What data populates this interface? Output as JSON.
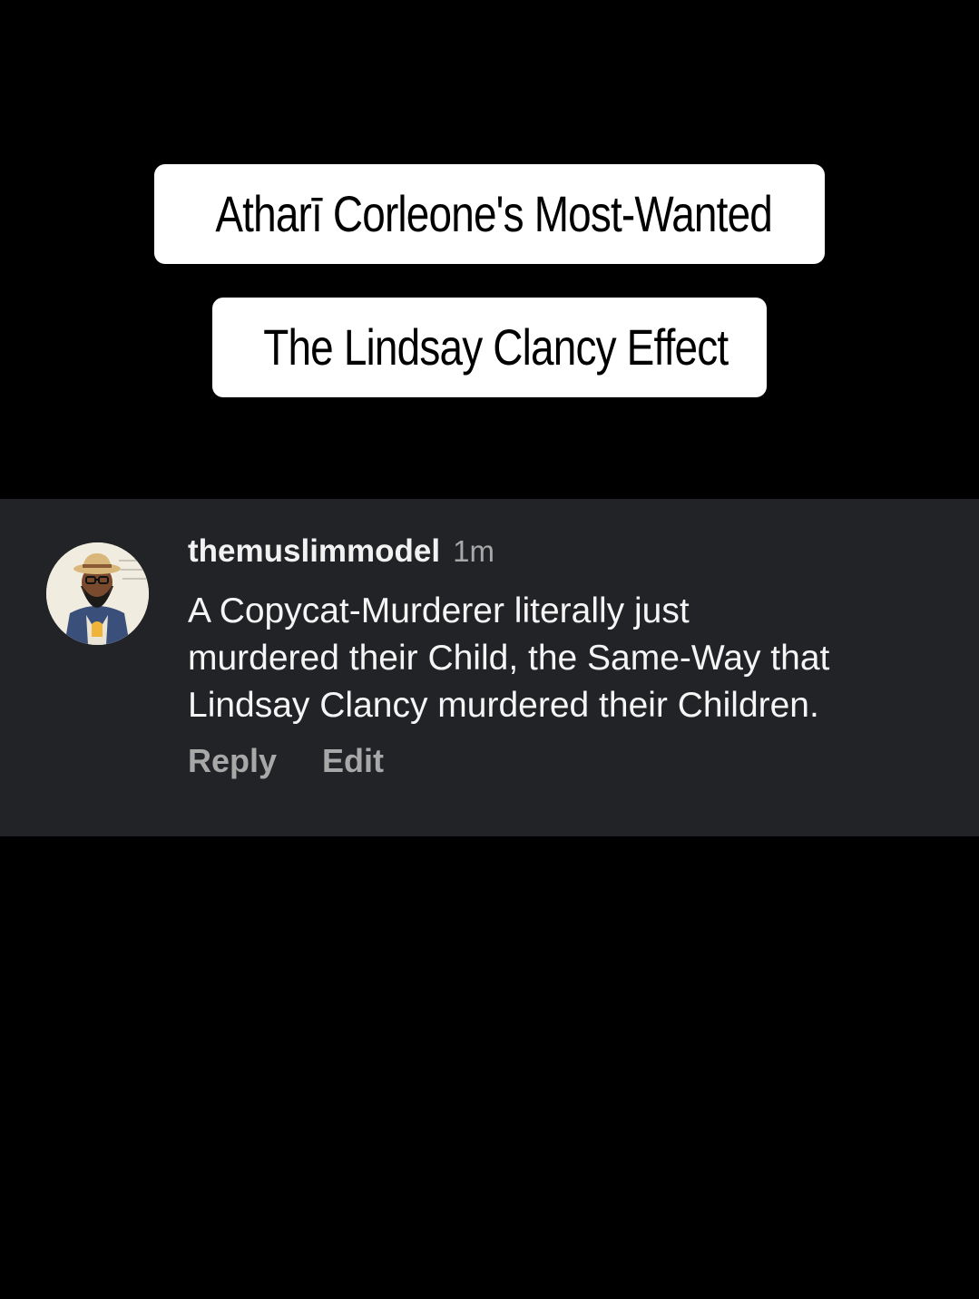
{
  "captions": {
    "line1": "Atharī Corleone's Most-Wanted",
    "line2": "The Lindsay Clancy Effect"
  },
  "comment": {
    "username": "themuslimmodel",
    "timestamp": "1m",
    "lines": [
      "A Copycat-Murderer literally just",
      "murdered their Child, the Same-Way that",
      "Lindsay Clancy murdered their Children."
    ],
    "actions": {
      "reply": "Reply",
      "edit": "Edit"
    }
  },
  "colors": {
    "background": "#000000",
    "card": "#222327",
    "caption_bg": "#ffffff",
    "text_primary": "#f5f5f5",
    "text_secondary": "#a8a8a8"
  }
}
